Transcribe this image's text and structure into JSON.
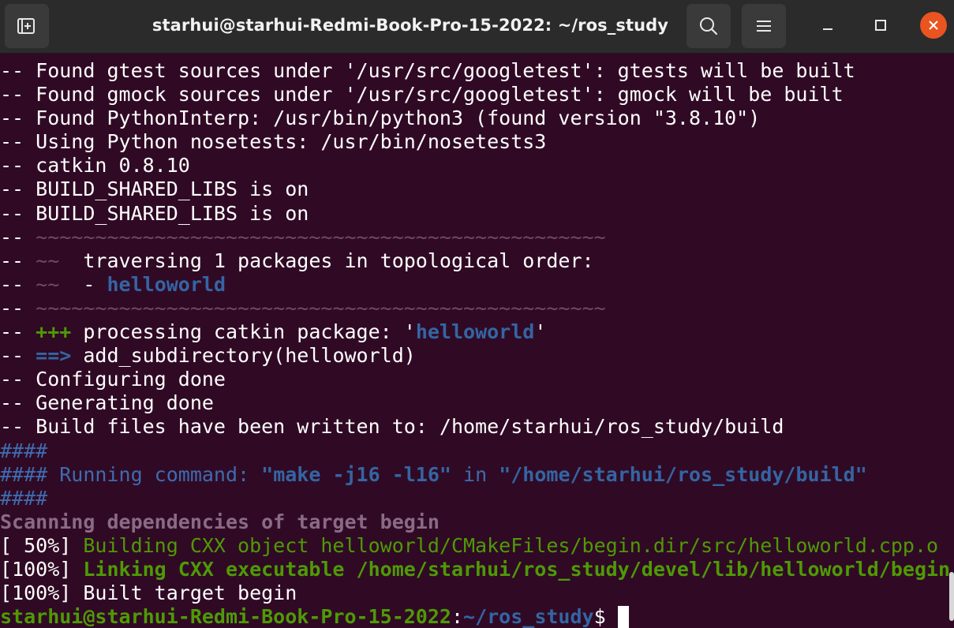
{
  "window": {
    "title": "starhui@starhui-Redmi-Book-Pro-15-2022: ~/ros_study"
  },
  "titlebar": {
    "new_tab_icon": "new-tab-icon",
    "search_icon": "search-icon",
    "menu_icon": "hamburger-menu-icon",
    "minimize_icon": "minimize-icon",
    "maximize_icon": "maximize-icon",
    "close_icon": "close-icon",
    "close_color": "#e95420"
  },
  "colors": {
    "background": "#300a24",
    "foreground": "#ffffff",
    "blue": "#3465a4",
    "green": "#4e9a06",
    "dim": "#6f4a64"
  },
  "terminal": {
    "lines": {
      "l1": "-- Found gtest sources under '/usr/src/googletest': gtests will be built",
      "l2": "-- Found gmock sources under '/usr/src/googletest': gmock will be built",
      "l3": "-- Found PythonInterp: /usr/bin/python3 (found version \"3.8.10\")",
      "l4": "-- Using Python nosetests: /usr/bin/nosetests3",
      "l5": "-- catkin 0.8.10",
      "l6": "-- BUILD_SHARED_LIBS is on",
      "l7": "-- BUILD_SHARED_LIBS is on"
    },
    "sep_prefix": "-- ",
    "separator": "~~~~~~~~~~~~~~~~~~~~~~~~~~~~~~~~~~~~~~~~~~~~~~~~",
    "tilde_short": "~~",
    "traverse_text": "  traversing 1 packages in topological order:",
    "package_dash": "  - ",
    "package_name": "helloworld",
    "plus_marker": "+++",
    "processing_text": " processing catkin package: '",
    "processing_pkg": "helloworld",
    "processing_end": "'",
    "arrow_marker": "==>",
    "add_subdir_text": " add_subdirectory(helloworld)",
    "configuring": "-- Configuring done",
    "generating": "-- Generating done",
    "build_files": "-- Build files have been written to: /home/starhui/ros_study/build",
    "hashes": "####",
    "running_prefix": "#### Running command: ",
    "running_cmd": "\"make -j16 -l16\"",
    "running_in": " in ",
    "running_dir": "\"/home/starhui/ros_study/build\"",
    "scanning": "Scanning dependencies of target begin",
    "pct50": "[ 50%] ",
    "building": "Building CXX object helloworld/CMakeFiles/begin.dir/src/helloworld.cpp.o",
    "pct100a": "[100%] ",
    "linking": "Linking CXX executable /home/starhui/ros_study/devel/lib/helloworld/begin",
    "built_target": "[100%] Built target begin",
    "prompt_user": "starhui@starhui-Redmi-Book-Pro-15-2022",
    "prompt_colon": ":",
    "prompt_path": "~/ros_study",
    "prompt_dollar": "$ "
  }
}
